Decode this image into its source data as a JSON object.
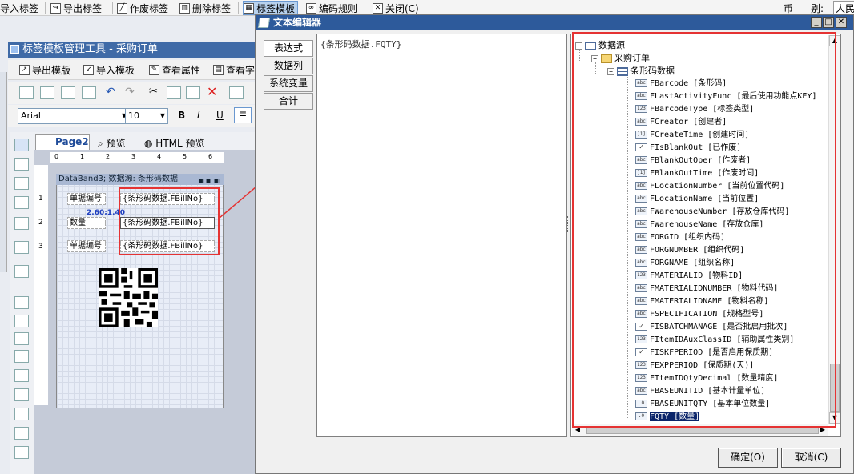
{
  "top_toolbar": {
    "items": [
      "导入标签",
      "导出标签",
      "作废标签",
      "删除标签",
      "标签模板",
      "编码规则",
      "关闭(C)"
    ],
    "right_labels": [
      "币",
      "别:",
      "人民"
    ]
  },
  "designer": {
    "title": "标签模板管理工具 - 采购订单",
    "toolbar1": [
      "导出模版",
      "导入模板",
      "查看属性",
      "查看字"
    ],
    "font_name": "Arial",
    "font_size": "10",
    "format_buttons": [
      "B",
      "I",
      "U"
    ],
    "tabs": [
      "Page2",
      "预览",
      "HTML 预览"
    ],
    "ruler_h": [
      "0",
      "1",
      "2",
      "3",
      "4",
      "5",
      "6"
    ],
    "ruler_v": [
      "1",
      "2",
      "3"
    ],
    "band_title": "DataBand3; 数据源: 条形码数据",
    "cells": [
      {
        "label": "单据编号",
        "value": "{条形码数据.FBillNo}"
      },
      {
        "label": "数量",
        "value": "{条形码数据.FBillNo}"
      },
      {
        "label": "单据编号",
        "value": "{条形码数据.FBillNo}"
      }
    ],
    "coord_label": "2.60;1.40"
  },
  "dialog": {
    "title": "文本编辑器",
    "side_tabs": [
      "表达式",
      "数据列",
      "系统变量",
      "合计"
    ],
    "editor_text": "{条形码数据.FQTY}",
    "tree": {
      "root": "数据源",
      "child": "采购订单",
      "table": "条形码数据",
      "fields": [
        {
          "icon": "abc",
          "text": "FBarcode [条形码]"
        },
        {
          "icon": "abc",
          "text": "FLastActivityFunc [最后使用功能点KEY]"
        },
        {
          "icon": "123",
          "text": "FBarcodeType [标签类型]"
        },
        {
          "icon": "abc",
          "text": "FCreator [创建者]"
        },
        {
          "icon": "date",
          "text": "FCreateTime [创建时间]"
        },
        {
          "icon": "check",
          "text": "FIsBlankOut [已作废]"
        },
        {
          "icon": "abc",
          "text": "FBlankOutOper [作废者]"
        },
        {
          "icon": "date",
          "text": "FBlankOutTime [作废时间]"
        },
        {
          "icon": "abc",
          "text": "FLocationNumber [当前位置代码]"
        },
        {
          "icon": "abc",
          "text": "FLocationName [当前位置]"
        },
        {
          "icon": "abc",
          "text": "FWarehouseNumber [存放仓库代码]"
        },
        {
          "icon": "abc",
          "text": "FWarehouseName [存放仓库]"
        },
        {
          "icon": "abc",
          "text": "FORGID [组织内码]"
        },
        {
          "icon": "abc",
          "text": "FORGNUMBER [组织代码]"
        },
        {
          "icon": "abc",
          "text": "FORGNAME [组织名称]"
        },
        {
          "icon": "123",
          "text": "FMATERIALID [物料ID]"
        },
        {
          "icon": "abc",
          "text": "FMATERIALIDNUMBER [物料代码]"
        },
        {
          "icon": "abc",
          "text": "FMATERIALIDNAME [物料名称]"
        },
        {
          "icon": "abc",
          "text": "FSPECIFICATION [规格型号]"
        },
        {
          "icon": "check",
          "text": "FISBATCHMANAGE [是否批启用批次]"
        },
        {
          "icon": "123",
          "text": "FItemIDAuxClassID [辅助属性类别]"
        },
        {
          "icon": "check",
          "text": "FISKFPERIOD [是否启用保质期]"
        },
        {
          "icon": "123",
          "text": "FEXPPERIOD [保质期(天)]"
        },
        {
          "icon": "123",
          "text": "FItemIDQtyDecimal [数量精度]"
        },
        {
          "icon": "abc",
          "text": "FBASEUNITID [基本计量单位]"
        },
        {
          "icon": "0",
          "text": "FBASEUNITQTY [基本单位数量]"
        },
        {
          "icon": "0",
          "text": "FQTY [数量]"
        }
      ]
    },
    "ok_button": "确定(O)",
    "cancel_button": "取消(C)"
  }
}
